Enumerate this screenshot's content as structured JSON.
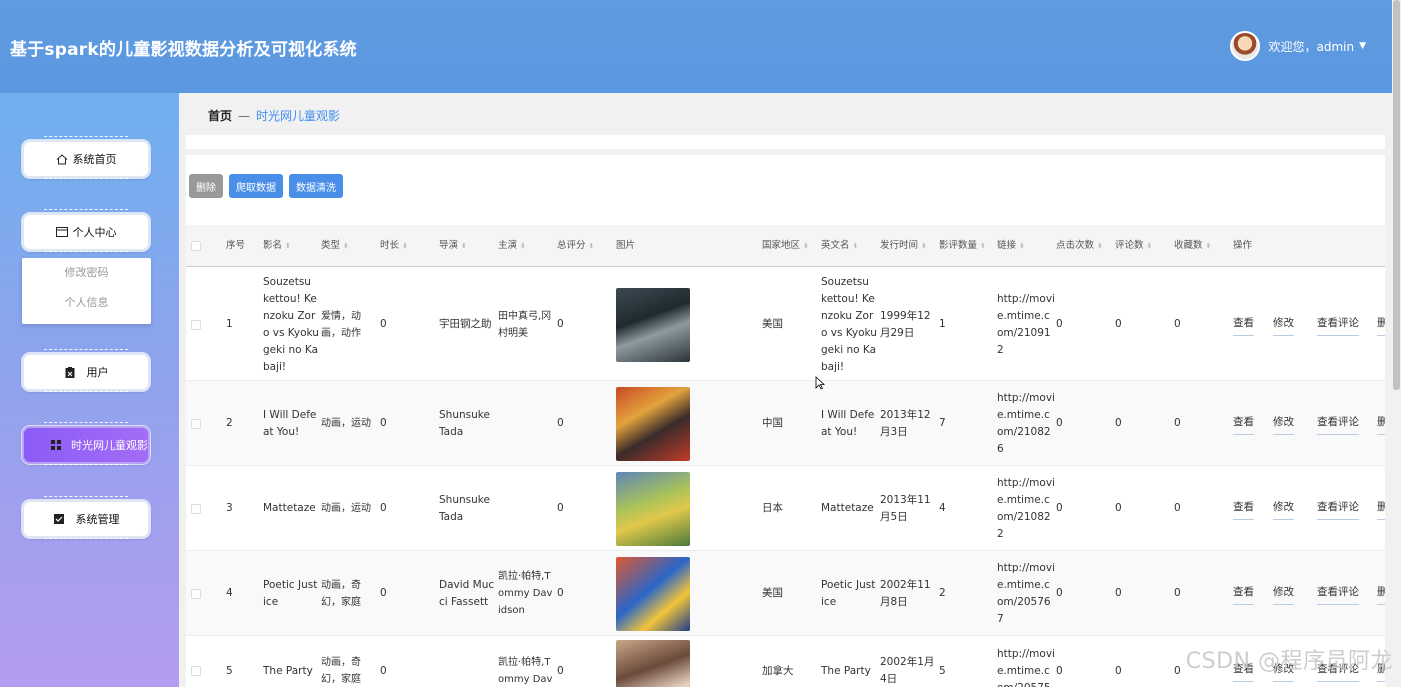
{
  "header": {
    "title": "基于spark的儿童影视数据分析及可视化系统",
    "greeting": "欢迎您，admin"
  },
  "sidebar": {
    "items": [
      {
        "label": "系统首页",
        "icon": "home-icon"
      },
      {
        "label": "个人中心",
        "icon": "window-icon"
      },
      {
        "label": "用户",
        "icon": "clipboard-icon"
      },
      {
        "label": "时光网儿童观影",
        "icon": "grid-icon"
      },
      {
        "label": "系统管理",
        "icon": "checkbox-icon"
      }
    ],
    "submenu": [
      "修改密码",
      "个人信息"
    ]
  },
  "breadcrumb": {
    "home": "首页",
    "sep": "—",
    "current": "时光网儿童观影"
  },
  "toolbar": {
    "delete": "删除",
    "crawl": "爬取数据",
    "clean": "数据清洗"
  },
  "table": {
    "headers": [
      "序号",
      "影名",
      "类型",
      "时长",
      "导演",
      "主演",
      "总评分",
      "图片",
      "国家地区",
      "英文名",
      "发行时间",
      "影评数量",
      "链接",
      "点击次数",
      "评论数",
      "收藏数",
      "操作"
    ],
    "actions": [
      "查看",
      "修改",
      "查看评论",
      "删"
    ],
    "rows": [
      {
        "no": "1",
        "name": "Souzetsu kettou! Kenzoku Zoro vs Kyokugeki no Kabaji!",
        "genre": "爱情，动画，动作",
        "duration": "0",
        "director": "宇田钢之助",
        "cast": "田中真弓,冈村明美",
        "score": "0",
        "country": "美国",
        "en_name": "Souzetsu kettou! Kenzoku Zoro vs Kyokugeki no Kabaji!",
        "release": "1999年12月29日",
        "reviews": "1",
        "link": "http://movie.mtime.com/210912",
        "clicks": "0",
        "comments": "0",
        "favorites": "0"
      },
      {
        "no": "2",
        "name": "I Will Defeat You!",
        "genre": "动画，运动",
        "duration": "0",
        "director": "Shunsuke Tada",
        "cast": "",
        "score": "0",
        "country": "中国",
        "en_name": "I Will Defeat You!",
        "release": "2013年12月3日",
        "reviews": "7",
        "link": "http://movie.mtime.com/210826",
        "clicks": "0",
        "comments": "0",
        "favorites": "0"
      },
      {
        "no": "3",
        "name": "Mattetaze",
        "genre": "动画，运动",
        "duration": "0",
        "director": "Shunsuke Tada",
        "cast": "",
        "score": "0",
        "country": "日本",
        "en_name": "Mattetaze",
        "release": "2013年11月5日",
        "reviews": "4",
        "link": "http://movie.mtime.com/210822",
        "clicks": "0",
        "comments": "0",
        "favorites": "0"
      },
      {
        "no": "4",
        "name": "Poetic Justice",
        "genre": "动画，奇幻，家庭",
        "duration": "0",
        "director": "David Mucci Fassett",
        "cast": "凯拉·帕特,Tommy Davidson",
        "score": "0",
        "country": "美国",
        "en_name": "Poetic Justice",
        "release": "2002年11月8日",
        "reviews": "2",
        "link": "http://movie.mtime.com/205767",
        "clicks": "0",
        "comments": "0",
        "favorites": "0"
      },
      {
        "no": "5",
        "name": "The Party",
        "genre": "动画，奇幻，家庭",
        "duration": "0",
        "director": "",
        "cast": "凯拉·帕特,Tommy Dav",
        "score": "0",
        "country": "加拿大",
        "en_name": "The Party",
        "release": "2002年1月4日",
        "reviews": "5",
        "link": "http://movie.mtime.com/20575",
        "clicks": "0",
        "comments": "0",
        "favorites": "0"
      }
    ]
  },
  "watermark": "CSDN @程序员阿龙",
  "colors": {
    "header": "#5b98e0",
    "accent": "#4a8fe7",
    "active": "#8b5cf6"
  }
}
